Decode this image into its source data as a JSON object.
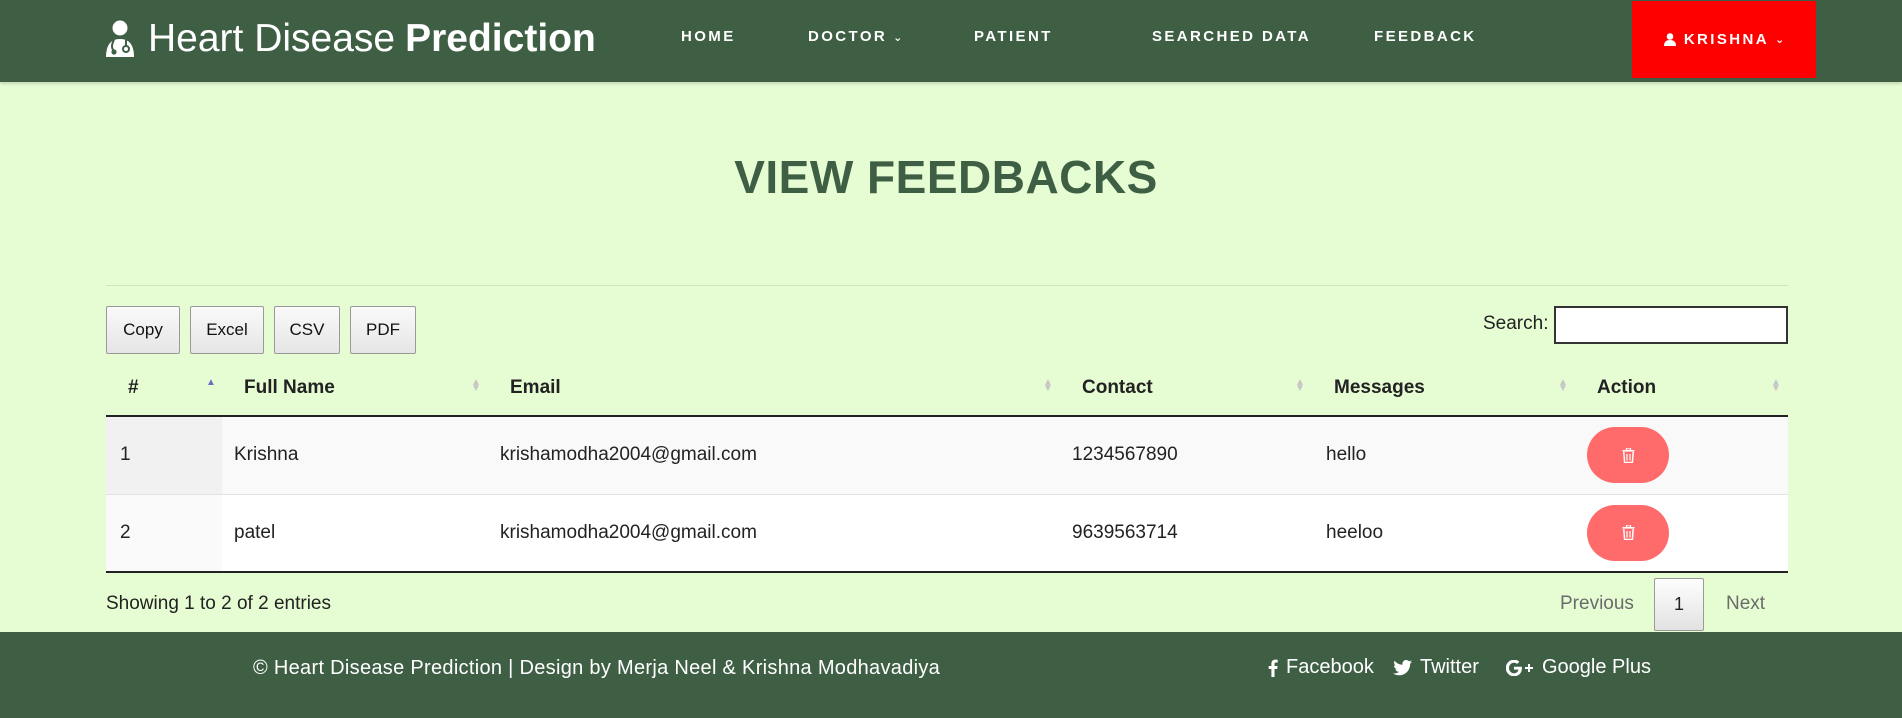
{
  "header": {
    "brand_light": "Heart Disease",
    "brand_bold": "Prediction",
    "nav": {
      "home": "HOME",
      "doctor": "DOCTOR",
      "patient": "PATIENT",
      "searched": "SEARCHED DATA",
      "feedback": "FEEDBACK"
    },
    "user": "KRISHNA"
  },
  "page": {
    "title": "VIEW FEEDBACKS"
  },
  "toolbar": {
    "copy": "Copy",
    "excel": "Excel",
    "csv": "CSV",
    "pdf": "PDF",
    "search_label": "Search:",
    "search_value": ""
  },
  "table": {
    "columns": [
      "#",
      "Full Name",
      "Email",
      "Contact",
      "Messages",
      "Action"
    ],
    "rows": [
      {
        "num": "1",
        "name": "Krishna",
        "email": "krishamodha2004@gmail.com",
        "contact": "1234567890",
        "message": "hello"
      },
      {
        "num": "2",
        "name": "patel",
        "email": "krishamodha2004@gmail.com",
        "contact": "9639563714",
        "message": "heeloo"
      }
    ]
  },
  "table_footer": {
    "info": "Showing 1 to 2 of 2 entries",
    "previous": "Previous",
    "current_page": "1",
    "next": "Next"
  },
  "footer": {
    "copyright": "© Heart Disease Prediction | Design by Merja Neel & Krishna Modhavadiya",
    "facebook": "Facebook",
    "twitter": "Twitter",
    "google": "Google Plus"
  },
  "colors": {
    "primary": "#3f5f45",
    "background": "#e6fdd4",
    "user_button": "#ff0000",
    "delete_button": "#ff6b6b"
  },
  "icons": {
    "brand": "doctor-icon",
    "user": "user-icon",
    "delete": "trash-icon",
    "facebook": "facebook-icon",
    "twitter": "twitter-icon",
    "google": "google-plus-icon"
  }
}
